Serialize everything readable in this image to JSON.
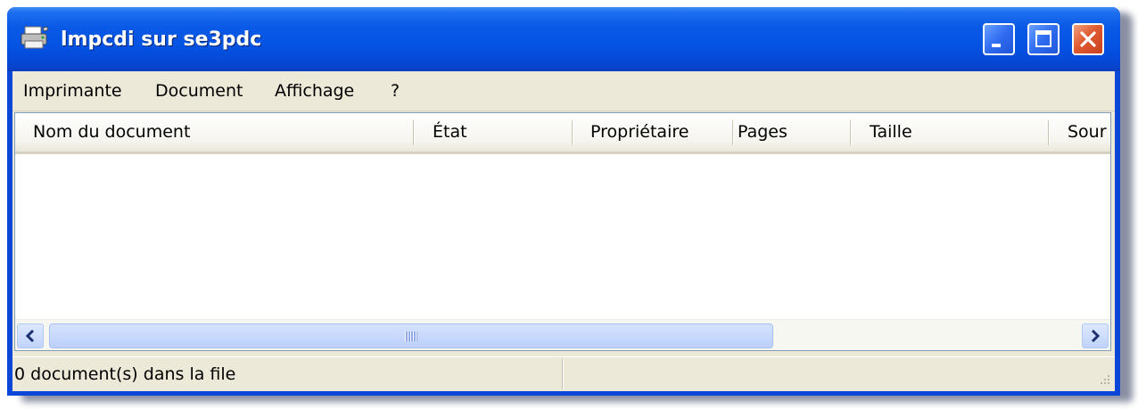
{
  "window": {
    "title": "lmpcdi sur se3pdc",
    "icon": "printer-icon",
    "controls": {
      "minimize": "minimize-icon",
      "maximize": "maximize-icon",
      "close": "close-icon"
    }
  },
  "menu": {
    "items": [
      {
        "label": "Imprimante"
      },
      {
        "label": "Document"
      },
      {
        "label": "Affichage"
      },
      {
        "label": "?"
      }
    ]
  },
  "list": {
    "columns": [
      {
        "label": "Nom du document"
      },
      {
        "label": "État"
      },
      {
        "label": "Propriétaire"
      },
      {
        "label": "Pages"
      },
      {
        "label": "Taille"
      },
      {
        "label": "Sour"
      }
    ],
    "rows": []
  },
  "scrollbar": {
    "left_arrow": "chevron-left-icon",
    "right_arrow": "chevron-right-icon"
  },
  "status": {
    "text": "0 document(s) dans la file"
  },
  "colors": {
    "titlebar": "#0553e3",
    "close_button": "#e05a30",
    "face": "#ece9d8"
  }
}
